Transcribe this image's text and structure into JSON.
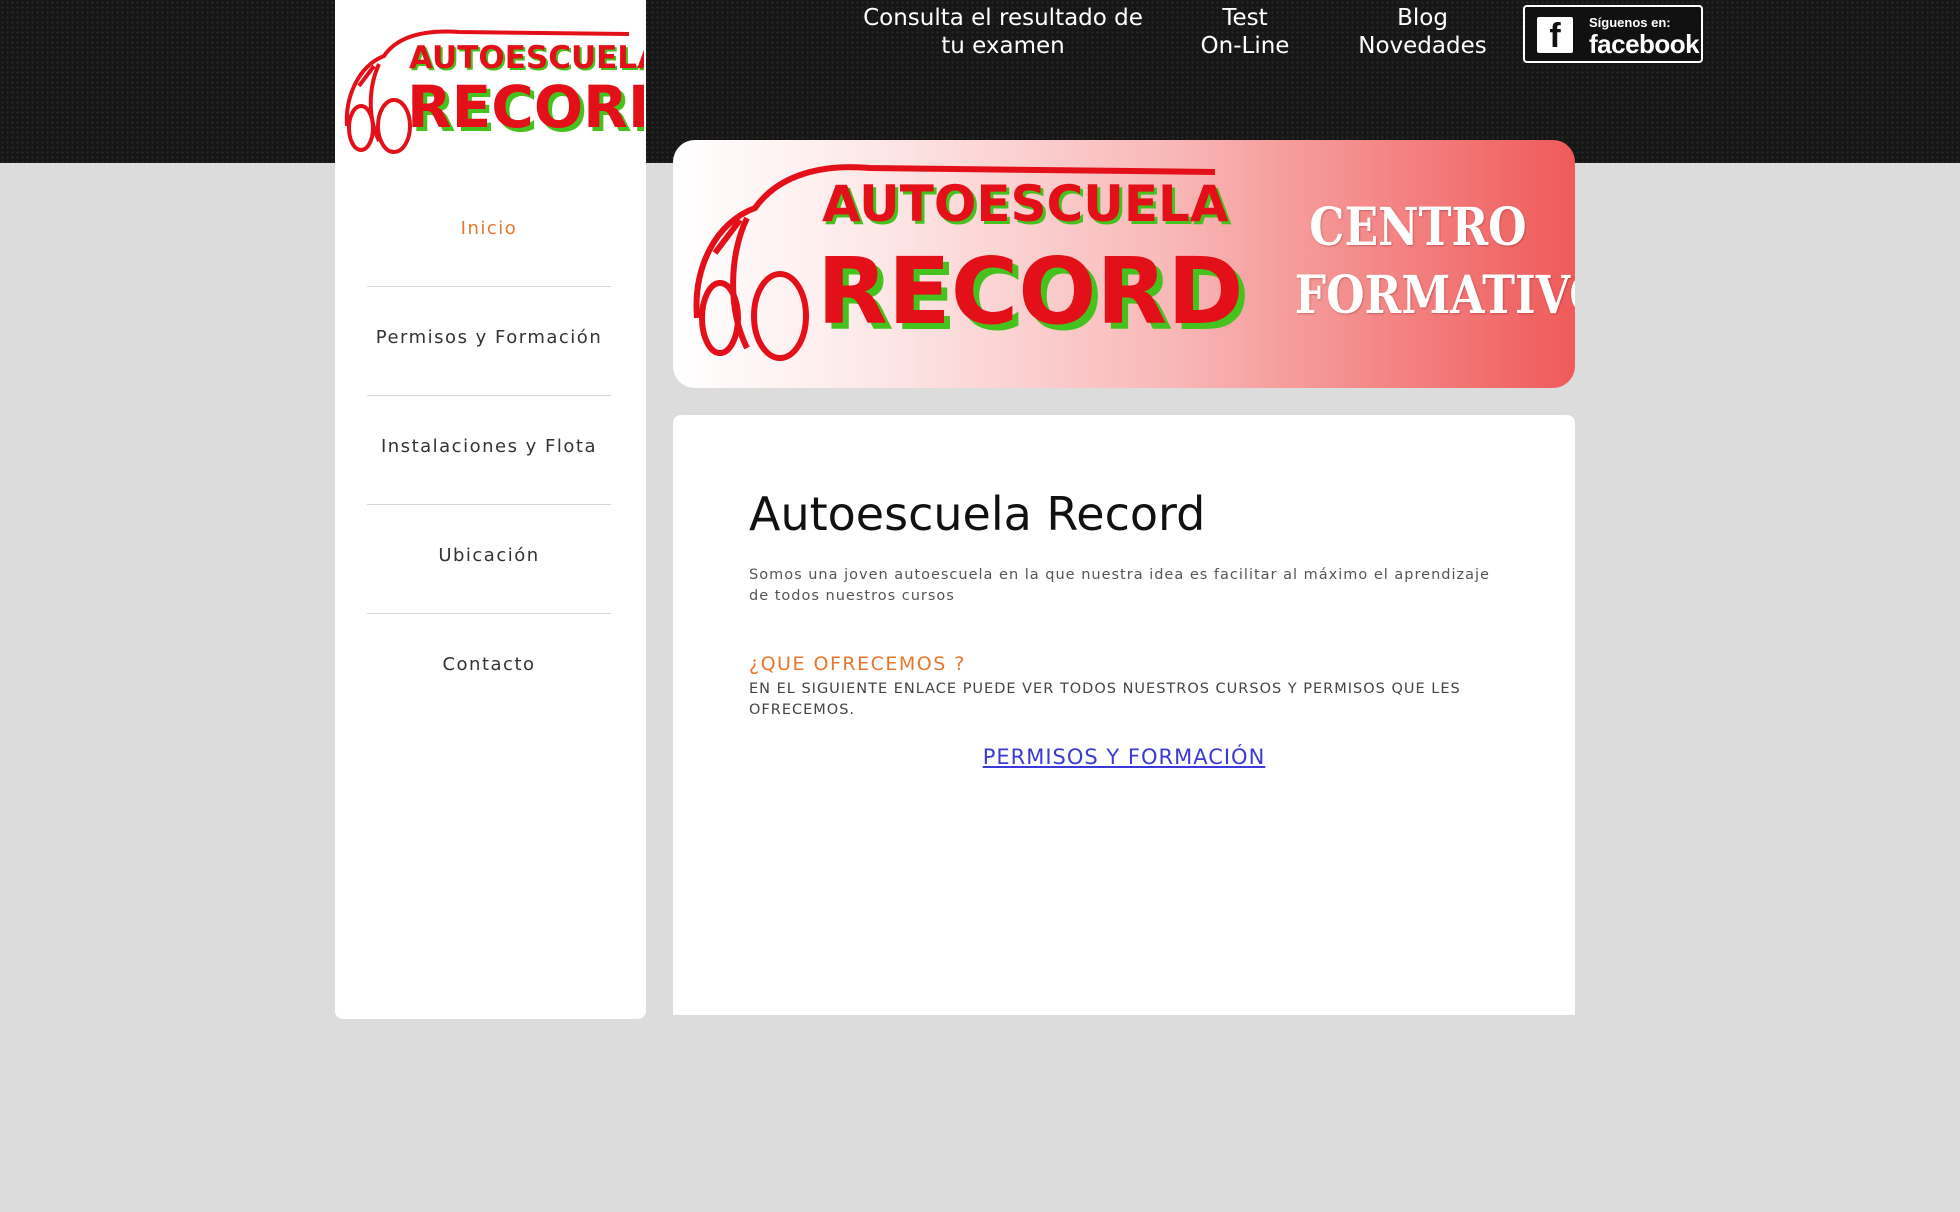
{
  "topnav": {
    "exam_result_line1": "Consulta el resultado de",
    "exam_result_line2": "tu examen",
    "test_line1": "Test",
    "test_line2": "On-Line",
    "blog_line1": "Blog",
    "blog_line2": "Novedades",
    "facebook_small": "Síguenos en:",
    "facebook_big": "facebook",
    "facebook_mark": "f"
  },
  "logo": {
    "top_text": "AUTOESCUELA",
    "bottom_text": "RECORD"
  },
  "sidebar": {
    "items": [
      {
        "label": "Inicio",
        "active": true
      },
      {
        "label": "Permisos y Formación"
      },
      {
        "label": "Instalaciones y Flota"
      },
      {
        "label": "Ubicación"
      },
      {
        "label": "Contacto"
      }
    ]
  },
  "banner": {
    "logo_top": "AUTOESCUELA",
    "logo_bottom": "RECORD",
    "tagline_line1": "CENTRO",
    "tagline_line2": "FORMATIVO"
  },
  "main": {
    "title": "Autoescuela Record",
    "intro": "Somos una joven autoescuela en la que nuestra idea es facilitar al máximo el aprendizaje de todos nuestros cursos",
    "offer_heading": "¿QUE OFRECEMOS ?",
    "offer_text": "EN EL SIGUIENTE ENLACE PUEDE VER TODOS NUESTROS CURSOS Y PERMISOS QUE LES OFRECEMOS.",
    "link_label": "PERMISOS Y FORMACIÓN"
  },
  "colors": {
    "accent_orange": "#e8762c",
    "logo_red": "#e3101a",
    "logo_green": "#46c21e",
    "link_blue": "#3a3ad8"
  }
}
